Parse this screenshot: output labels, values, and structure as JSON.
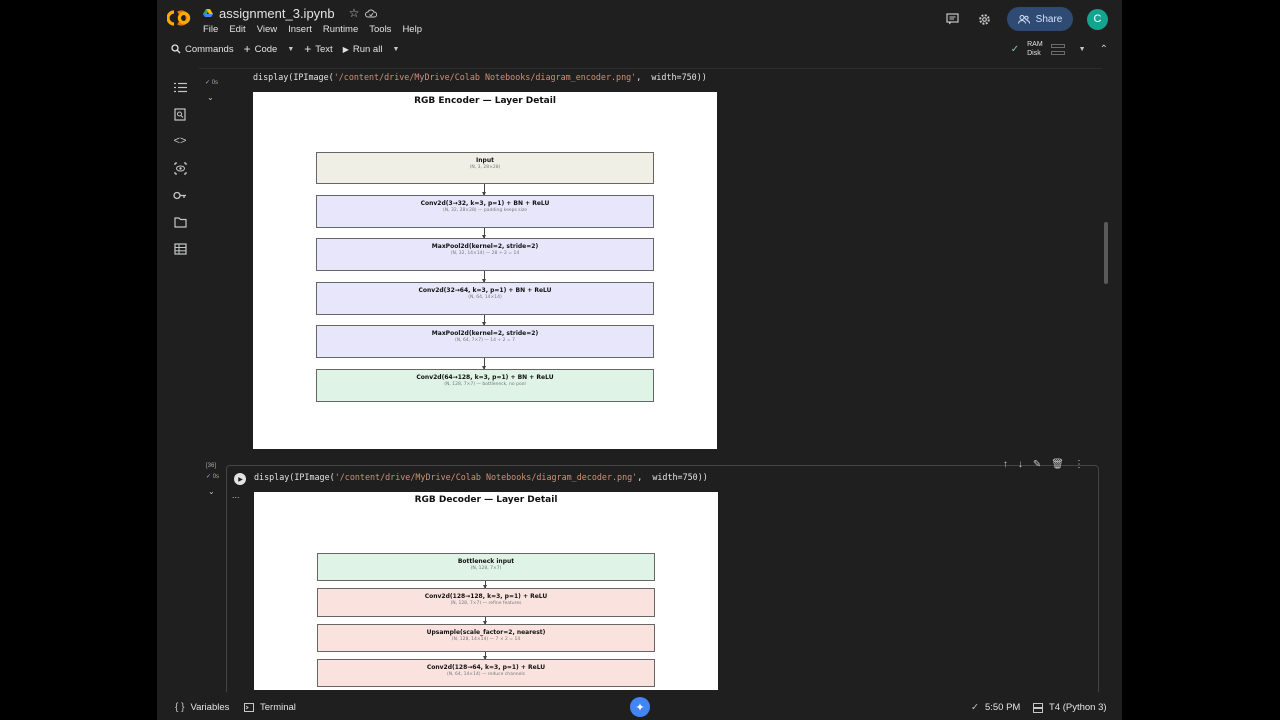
{
  "header": {
    "file_name": "assignment_3.ipynb",
    "menu": [
      "File",
      "Edit",
      "View",
      "Insert",
      "Runtime",
      "Tools",
      "Help"
    ],
    "share_label": "Share",
    "avatar_letter": "C",
    "brand_color": "#f9ab00"
  },
  "toolbar": {
    "commands_label": "Commands",
    "code_label": "Code",
    "text_label": "Text",
    "run_all_label": "Run all",
    "ram_label": "RAM",
    "disk_label": "Disk"
  },
  "cell1": {
    "exec_time": "0s",
    "code_prefix": "display(IPImage(",
    "code_string": "'/content/drive/MyDrive/Colab Notebooks/diagram_encoder.png'",
    "code_suffix": ",  width=750))",
    "diagram": {
      "title": "RGB Encoder — Layer Detail",
      "layers": [
        {
          "name": "Input",
          "shape": "(N, 3, 28×28)",
          "color": "#f0efe6"
        },
        {
          "name": "Conv2d(3→32, k=3, p=1) + BN + ReLU",
          "shape": "(N, 32, 28×28)  — padding keeps size",
          "color": "#e7e6fb"
        },
        {
          "name": "MaxPool2d(kernel=2, stride=2)",
          "shape": "(N, 32, 14×14)  — 28 ÷ 2 = 14",
          "color": "#e7e6fb"
        },
        {
          "name": "Conv2d(32→64, k=3, p=1) + BN + ReLU",
          "shape": "(N, 64, 14×14)",
          "color": "#e7e6fb"
        },
        {
          "name": "MaxPool2d(kernel=2, stride=2)",
          "shape": "(N, 64, 7×7)  — 14 ÷ 2 = 7",
          "color": "#e7e6fb"
        },
        {
          "name": "Conv2d(64→128, k=3, p=1) + BN + ReLU",
          "shape": "(N, 128, 7×7)  — bottleneck, no pool",
          "color": "#dff3e7"
        }
      ]
    }
  },
  "cell2": {
    "exec_count": "[36]",
    "exec_time": "0s",
    "code_prefix": "display(IPImage(",
    "code_string": "'/content/drive/MyDrive/Colab Notebooks/diagram_decoder.png'",
    "code_suffix": ",  width=750))",
    "output_menu": "...",
    "diagram": {
      "title": "RGB Decoder — Layer Detail",
      "layers": [
        {
          "name": "Bottleneck input",
          "shape": "(N, 128, 7×7)",
          "color": "#dff3e7"
        },
        {
          "name": "Conv2d(128→128, k=3, p=1) + ReLU",
          "shape": "(N, 128, 7×7)  — refine features",
          "color": "#fae3df"
        },
        {
          "name": "Upsample(scale_factor=2, nearest)",
          "shape": "(N, 128, 14×14)  — 7 × 2 = 14",
          "color": "#fae3df"
        },
        {
          "name": "Conv2d(128→64, k=3, p=1) + ReLU",
          "shape": "(N, 64, 14×14)  — reduce channels",
          "color": "#fae3df"
        }
      ]
    }
  },
  "statusbar": {
    "variables_label": "Variables",
    "terminal_label": "Terminal",
    "time": "5:50 PM",
    "runtime": "T4 (Python 3)"
  }
}
